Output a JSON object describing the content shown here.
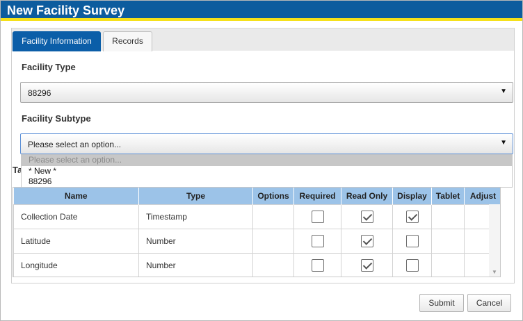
{
  "window": {
    "title": "New Facility Survey"
  },
  "tabs": [
    {
      "label": "Facility Information",
      "active": true
    },
    {
      "label": "Records",
      "active": false
    }
  ],
  "facility_type": {
    "label": "Facility Type",
    "value": "88296"
  },
  "facility_subtype": {
    "label": "Facility Subtype",
    "value": "Please select an option...",
    "options": [
      "Please select an option...",
      "* New *",
      "88296"
    ]
  },
  "table_label": "Ta",
  "grid": {
    "columns": [
      "Name",
      "Type",
      "Options",
      "Required",
      "Read Only",
      "Display",
      "Tablet",
      "Adjust"
    ],
    "rows": [
      {
        "name": "Collection Date",
        "type": "Timestamp",
        "required": false,
        "read_only": true,
        "display": true
      },
      {
        "name": "Latitude",
        "type": "Number",
        "required": false,
        "read_only": true,
        "display": false
      },
      {
        "name": "Longitude",
        "type": "Number",
        "required": false,
        "read_only": true,
        "display": false
      }
    ]
  },
  "buttons": {
    "submit": "Submit",
    "cancel": "Cancel"
  },
  "colors": {
    "title_bar": "#0d5c9e",
    "accent_stripe": "#f5e01a",
    "active_tab": "#0b5ea8",
    "grid_header": "#9cc3e8"
  }
}
